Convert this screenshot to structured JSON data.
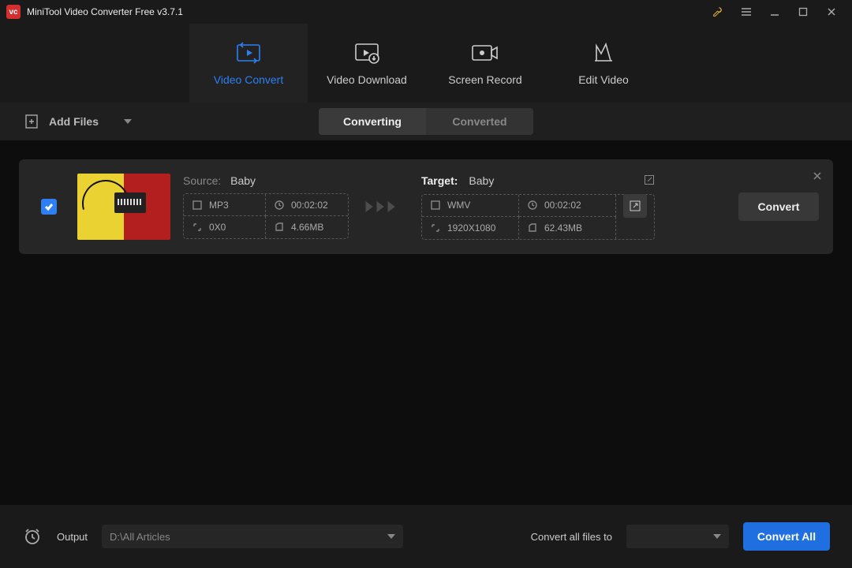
{
  "title": "MiniTool Video Converter Free v3.7.1",
  "nav": {
    "tabs": [
      {
        "label": "Video Convert"
      },
      {
        "label": "Video Download"
      },
      {
        "label": "Screen Record"
      },
      {
        "label": "Edit Video"
      }
    ]
  },
  "toolbar": {
    "add_files": "Add Files",
    "seg_converting": "Converting",
    "seg_converted": "Converted"
  },
  "file": {
    "source_label": "Source:",
    "source_name": "Baby",
    "target_label": "Target:",
    "target_name": "Baby",
    "src": {
      "format": "MP3",
      "duration": "00:02:02",
      "resolution": "0X0",
      "size": "4.66MB"
    },
    "tgt": {
      "format": "WMV",
      "duration": "00:02:02",
      "resolution": "1920X1080",
      "size": "62.43MB"
    },
    "convert_btn": "Convert"
  },
  "bottom": {
    "output_label": "Output",
    "output_path": "D:\\All Articles",
    "convert_all_to_label": "Convert all files to",
    "convert_all_btn": "Convert All"
  }
}
